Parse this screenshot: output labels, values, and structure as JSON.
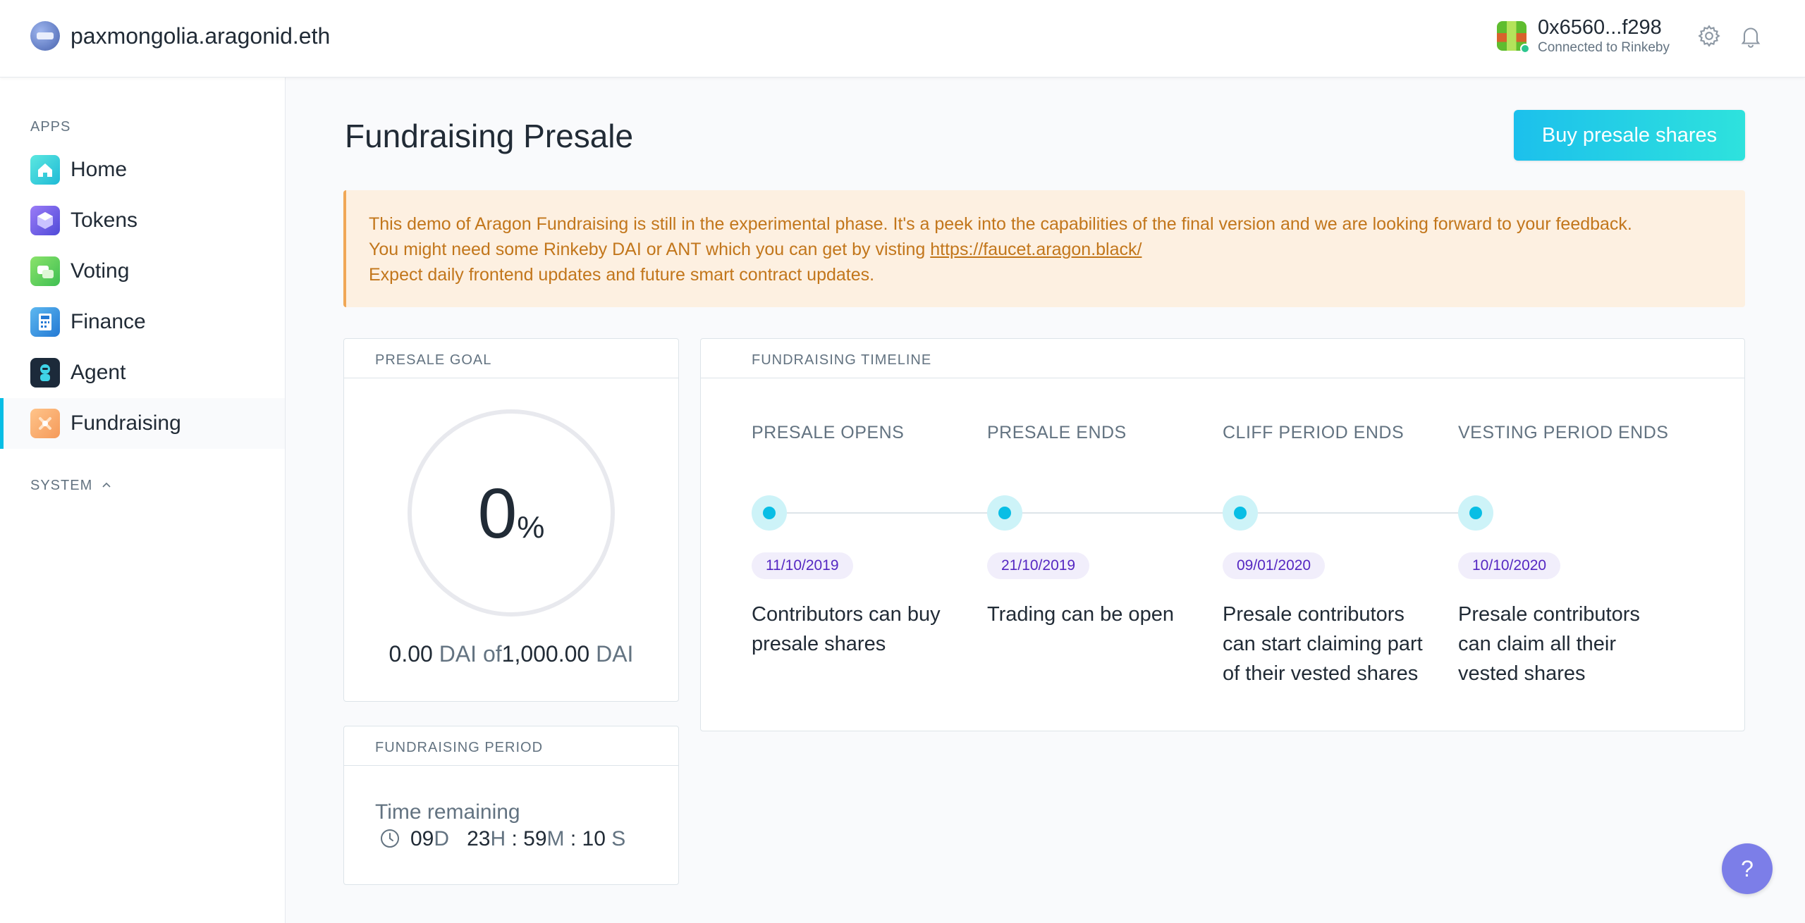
{
  "header": {
    "org_name": "paxmongolia.aragonid.eth",
    "account_address": "0x6560...f298",
    "account_network": "Connected to Rinkeby",
    "icons": [
      "settings-gear-icon",
      "notifications-bell-icon"
    ]
  },
  "sidebar": {
    "apps_heading": "APPS",
    "system_heading": "SYSTEM",
    "items": [
      {
        "label": "Home",
        "icon": "home-icon",
        "color": "#2fd4d9"
      },
      {
        "label": "Tokens",
        "icon": "tokens-icon",
        "color": "#7a5cf0"
      },
      {
        "label": "Voting",
        "icon": "voting-icon",
        "color": "#64d25a"
      },
      {
        "label": "Finance",
        "icon": "finance-icon",
        "color": "#3ba3e8"
      },
      {
        "label": "Agent",
        "icon": "agent-icon",
        "color": "#1c2a3a"
      },
      {
        "label": "Fundraising",
        "icon": "fundraising-icon",
        "color": "#f7a869",
        "active": true
      }
    ]
  },
  "main": {
    "title": "Fundraising Presale",
    "buy_button": "Buy presale shares",
    "notice": {
      "line1": "This demo of Aragon Fundraising is still in the experimental phase. It's a peek into the capabilities of the final version and we are looking forward to your feedback.",
      "line2_prefix": "You might need some Rinkeby DAI or ANT which you can get by visting ",
      "line2_link": "https://faucet.aragon.black/",
      "line3": "Expect daily frontend updates and future smart contract updates."
    },
    "presale_goal": {
      "title": "PRESALE GOAL",
      "percent": "0",
      "percent_sign": "%",
      "raised": "0.00",
      "unit": "DAI",
      "of": "of",
      "goal": "1,000.00",
      "progress_fraction": 0
    },
    "fundraising_period": {
      "title": "FUNDRAISING PERIOD",
      "time_label": "Time remaining",
      "days": "09",
      "days_unit": "D",
      "hours": "23",
      "hours_unit": "H",
      "minutes": "59",
      "minutes_unit": "M",
      "seconds": "10",
      "seconds_unit": "S",
      "sep": ":"
    },
    "timeline": {
      "title": "FUNDRAISING TIMELINE",
      "steps": [
        {
          "name": "PRESALE OPENS",
          "date": "11/10/2019",
          "desc": "Contributors can buy presale shares"
        },
        {
          "name": "PRESALE ENDS",
          "date": "21/10/2019",
          "desc": "Trading can be open"
        },
        {
          "name": "CLIFF PERIOD ENDS",
          "date": "09/01/2020",
          "desc": "Presale contributors can start claiming part of their vested shares"
        },
        {
          "name": "VESTING PERIOD ENDS",
          "date": "10/10/2020",
          "desc": "Presale contributors can claim all their vested shares"
        }
      ]
    }
  },
  "help_button": "?"
}
